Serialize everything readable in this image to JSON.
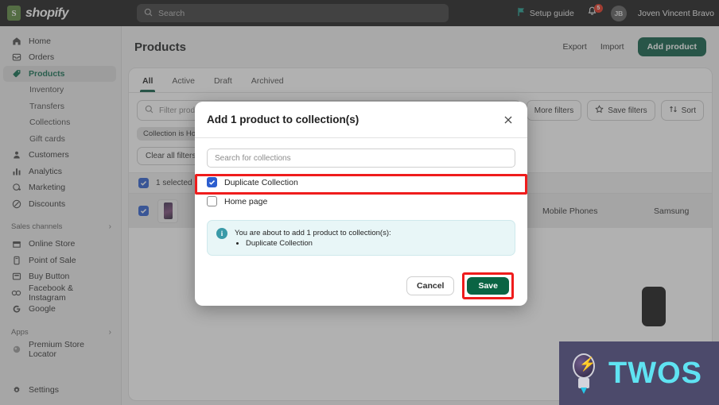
{
  "topbar": {
    "brand_name": "shopify",
    "brand_mark_letter": "S",
    "search_placeholder": "Search",
    "setup_guide_label": "Setup guide",
    "notification_count": "5",
    "avatar_initials": "JB",
    "user_name": "Joven Vincent Bravo"
  },
  "sidebar": {
    "items": [
      {
        "label": "Home",
        "icon": "home-icon"
      },
      {
        "label": "Orders",
        "icon": "orders-icon"
      },
      {
        "label": "Products",
        "icon": "products-tag-icon"
      },
      {
        "label": "Inventory",
        "icon": ""
      },
      {
        "label": "Transfers",
        "icon": ""
      },
      {
        "label": "Collections",
        "icon": ""
      },
      {
        "label": "Gift cards",
        "icon": ""
      },
      {
        "label": "Customers",
        "icon": "customer-icon"
      },
      {
        "label": "Analytics",
        "icon": "analytics-bars-icon"
      },
      {
        "label": "Marketing",
        "icon": "marketing-icon"
      },
      {
        "label": "Discounts",
        "icon": "discount-icon"
      }
    ],
    "sales_channels_header": "Sales channels",
    "sales_channels": [
      {
        "label": "Online Store",
        "icon": "store-icon"
      },
      {
        "label": "Point of Sale",
        "icon": "pos-icon"
      },
      {
        "label": "Buy Button",
        "icon": "buy-button-icon"
      },
      {
        "label": "Facebook & Instagram",
        "icon": "facebook-instagram-icon"
      },
      {
        "label": "Google",
        "icon": "google-icon"
      }
    ],
    "apps_header": "Apps",
    "apps": [
      {
        "label": "Premium Store Locator",
        "icon": "app-icon"
      }
    ],
    "settings_label": "Settings"
  },
  "page": {
    "title": "Products",
    "export_label": "Export",
    "import_label": "Import",
    "add_product_label": "Add product"
  },
  "tabs": [
    {
      "label": "All"
    },
    {
      "label": "Active"
    },
    {
      "label": "Draft"
    },
    {
      "label": "Archived"
    }
  ],
  "filters": {
    "filter_placeholder": "Filter products",
    "more_filters_label": "More filters",
    "save_filters_label": "Save filters",
    "sort_label": "Sort",
    "chip_label": "Collection is Home page",
    "clear_all_label": "Clear all filters",
    "selected_label": "1 selected"
  },
  "table": {
    "row": {
      "type": "Mobile Phones",
      "vendor": "Samsung"
    }
  },
  "modal": {
    "title": "Add 1 product to collection(s)",
    "close_icon": "close-icon",
    "search_placeholder": "Search for collections",
    "collections": [
      {
        "label": "Duplicate Collection",
        "checked": true
      },
      {
        "label": "Home page",
        "checked": false
      }
    ],
    "info": {
      "text": "You are about to add 1 product to collection(s):",
      "items": [
        "Duplicate Collection"
      ]
    },
    "cancel_label": "Cancel",
    "save_label": "Save"
  },
  "watermark": {
    "text": "TWOS"
  },
  "colors": {
    "brand_green": "#0c5c44",
    "accent_blue": "#2c5ecf",
    "highlight_red": "#ef1c1c",
    "info_bg": "#e8f6f7",
    "watermark_cyan": "#5fe3f2"
  }
}
